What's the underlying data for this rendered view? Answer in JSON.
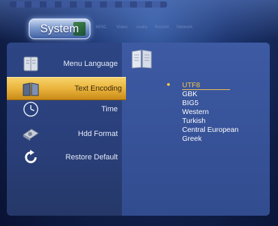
{
  "header": {
    "active_tab": "System",
    "inactive_tabs": [
      "MISC",
      "Video",
      "Audio",
      "Record",
      "Network"
    ]
  },
  "menu": {
    "items": [
      {
        "label": "Menu Language",
        "icon": "book-icon"
      },
      {
        "label": "Text Encoding",
        "icon": "book-open-icon",
        "selected": true
      },
      {
        "label": "Time",
        "icon": "clock-icon"
      },
      {
        "label": "Hdd Format",
        "icon": "hard-drive-icon"
      },
      {
        "label": "Restore Default",
        "icon": "restore-arrow-icon"
      }
    ]
  },
  "options": {
    "items": [
      "UTF8",
      "GBK",
      "BIG5",
      "Western",
      "Turkish",
      "Central European",
      "Greek"
    ],
    "selected": "UTF8"
  },
  "colors": {
    "highlight": "#eab43c",
    "current_option": "#f6c44a",
    "panel_left": "#2d4584",
    "panel_right": "#3d5aa3"
  }
}
